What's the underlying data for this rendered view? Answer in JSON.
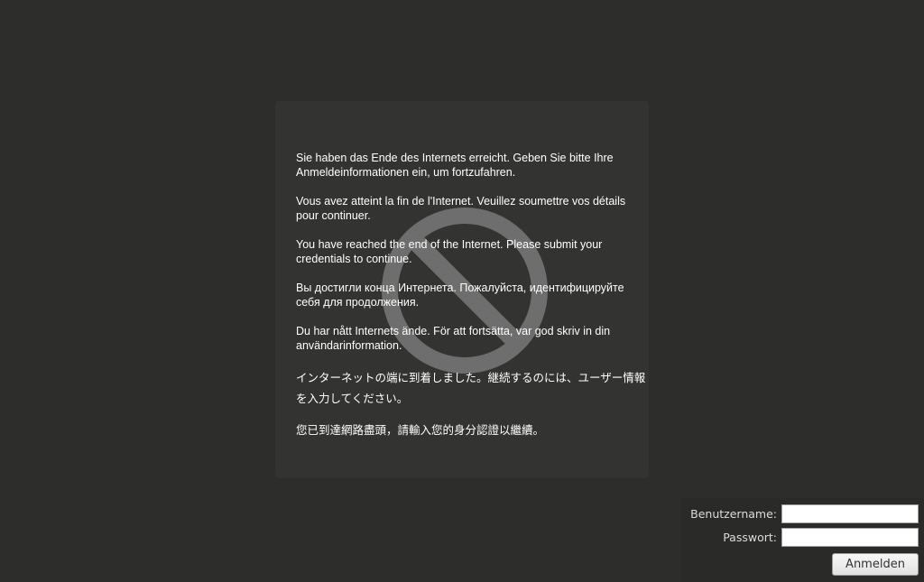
{
  "messages": [
    "Sie haben das Ende des Internets erreicht. Geben Sie bitte Ihre Anmeldeinformationen ein, um fortzufahren.",
    "Vous avez atteint la fin de l'Internet. Veuillez soumettre vos détails pour continuer.",
    "You have reached the end of the Internet. Please submit your credentials to continue.",
    "Вы достигли конца Интернета. Пожалуйста, идентифицируйте себя для продолжения.",
    "Du har nått Internets ände. För att fortsätta, var god skriv in din användarinformation.",
    "インターネットの端に到着しました。継続するのには、ユーザー情報を入力してください。",
    "您已到達網路盡頭，請輸入您的身分認證以繼續。"
  ],
  "icons": {
    "background_icon": "no-entry-icon"
  },
  "login": {
    "username_label": "Benutzername:",
    "username_value": "",
    "password_label": "Passwort:",
    "password_value": "",
    "submit_label": "Anmelden"
  },
  "colors": {
    "page_background": "#2d2d2c",
    "box_background": "#333332",
    "icon_color": "#6e6e6e",
    "text_color": "#ffffff"
  }
}
